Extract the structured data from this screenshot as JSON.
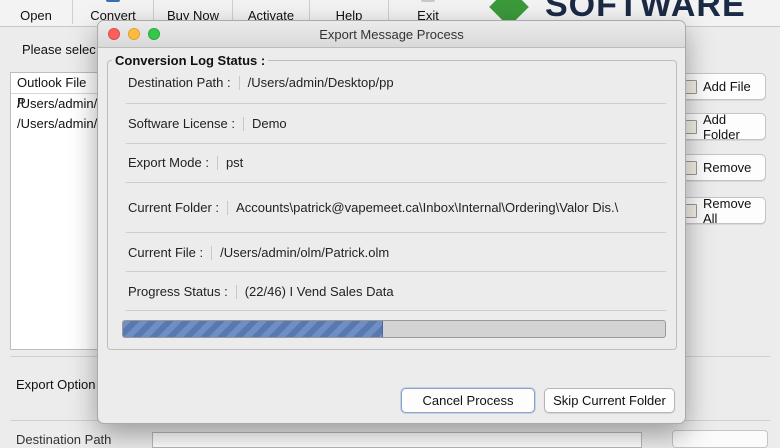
{
  "toolbar": {
    "items": [
      {
        "label": "Open"
      },
      {
        "label": "Convert"
      },
      {
        "label": "Buy Now"
      },
      {
        "label": "Activate"
      },
      {
        "label": "Help"
      },
      {
        "label": "Exit"
      }
    ],
    "brand_text": "SOFTWARE"
  },
  "main": {
    "select_text": "Please selec",
    "file_panel_header": "Outlook File P",
    "files": [
      "/Users/admin/",
      "/Users/admin/"
    ],
    "side_buttons": [
      "Add File",
      "Add Folder",
      "Remove",
      "Remove All"
    ],
    "export_options_label": "Export Option",
    "destination_label": "Destination Path"
  },
  "dialog": {
    "title": "Export Message Process",
    "group_title": "Conversion Log Status :",
    "rows": [
      {
        "label": "Destination Path :",
        "value": "/Users/admin/Desktop/pp"
      },
      {
        "label": "Software License  :",
        "value": "Demo"
      },
      {
        "label": "Export Mode :",
        "value": "pst"
      },
      {
        "label": "Current Folder :",
        "value": "Accounts\\patrick@vapemeet.ca\\Inbox\\Internal\\Ordering\\Valor Dis.\\"
      },
      {
        "label": "Current File :",
        "value": "/Users/admin/olm/Patrick.olm"
      },
      {
        "label": "Progress Status :",
        "value": "(22/46) I Vend Sales Data"
      }
    ],
    "progress": {
      "fraction": 0.478
    },
    "buttons": {
      "cancel": "Cancel Process",
      "skip": "Skip Current Folder"
    }
  },
  "colors": {
    "brand": "#3b9a3b",
    "progress": "#6f8fc4"
  }
}
